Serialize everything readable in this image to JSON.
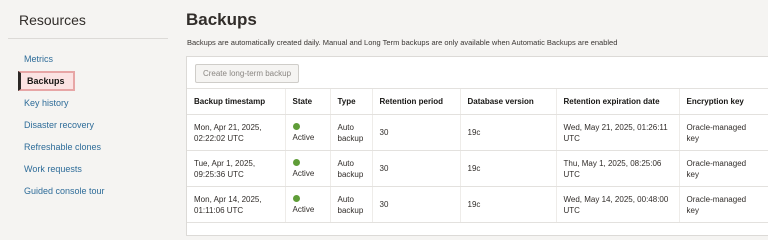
{
  "sidebar": {
    "title": "Resources",
    "items": [
      {
        "label": "Metrics",
        "active": false
      },
      {
        "label": "Backups",
        "active": true
      },
      {
        "label": "Key history",
        "active": false
      },
      {
        "label": "Disaster recovery",
        "active": false
      },
      {
        "label": "Refreshable clones",
        "active": false
      },
      {
        "label": "Work requests",
        "active": false
      },
      {
        "label": "Guided console tour",
        "active": false
      }
    ]
  },
  "main": {
    "title": "Backups",
    "description": "Backups are automatically created daily. Manual and Long Term backups are only available when Automatic Backups are enabled",
    "create_button_label": "Create long-term backup",
    "columns": [
      "Backup timestamp",
      "State",
      "Type",
      "Retention period",
      "Database version",
      "Retention expiration date",
      "Encryption key"
    ],
    "rows": [
      {
        "timestamp": [
          "Mon, Apr 21, 2025,",
          "02:22:02 UTC"
        ],
        "state": "Active",
        "type": [
          "Auto",
          "backup"
        ],
        "retention_period": "30",
        "db_version": "19c",
        "expiration": [
          "Wed, May 21, 2025, 01:26:11",
          "UTC"
        ],
        "encryption": [
          "Oracle-managed",
          "key"
        ]
      },
      {
        "timestamp": [
          "Tue, Apr 1, 2025,",
          "09:25:36 UTC"
        ],
        "state": "Active",
        "type": [
          "Auto",
          "backup"
        ],
        "retention_period": "30",
        "db_version": "19c",
        "expiration": [
          "Thu, May 1, 2025, 08:25:06",
          "UTC"
        ],
        "encryption": [
          "Oracle-managed",
          "key"
        ]
      },
      {
        "timestamp": [
          "Mon, Apr 14, 2025,",
          "01:11:06 UTC"
        ],
        "state": "Active",
        "type": [
          "Auto",
          "backup"
        ],
        "retention_period": "30",
        "db_version": "19c",
        "expiration": [
          "Wed, May 14, 2025, 00:48:00",
          "UTC"
        ],
        "encryption": [
          "Oracle-managed",
          "key"
        ]
      }
    ]
  },
  "colors": {
    "link": "#2e6c99",
    "active_state": "#5f9d38",
    "highlight_border": "#e7a6a6"
  }
}
